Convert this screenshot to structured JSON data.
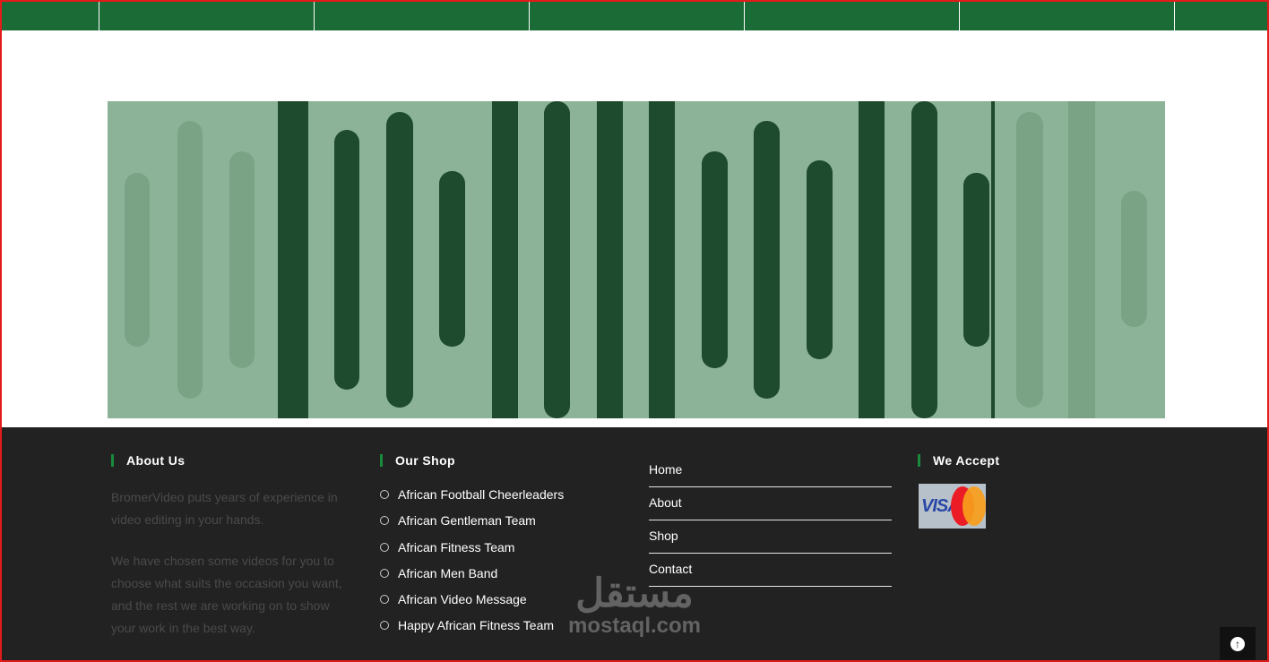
{
  "about": {
    "heading": "About Us",
    "paragraph1": "BromerVideo puts years of experience in video editing in your hands.",
    "paragraph2": "We have chosen some videos for you to choose what suits the occasion you want, and the rest we are working on to show your work in the best way."
  },
  "shop": {
    "heading": "Our Shop",
    "items": [
      "African Football Cheerleaders",
      "African Gentleman Team",
      "African Fitness Team",
      "African Men Band",
      "African Video Message",
      "Happy African Fitness Team"
    ]
  },
  "menu": {
    "items": [
      "Home",
      "About",
      "Shop",
      "Contact"
    ]
  },
  "accept": {
    "heading": "We Accept",
    "card_logo_text": "VISA"
  },
  "watermark": {
    "arabic": "مستقل",
    "latin": "mostaql.com"
  },
  "scroll_top": {
    "icon": "arrow-up-icon"
  },
  "colors": {
    "nav_green": "#1a6b35",
    "hero_bg": "#8cb397",
    "hero_bar_dark": "#1e4a2d",
    "hero_bar_faint": "#7aa386",
    "footer_bg": "#222222",
    "heading_accent": "#1a8a3c",
    "frame_red": "#e21b1b"
  }
}
